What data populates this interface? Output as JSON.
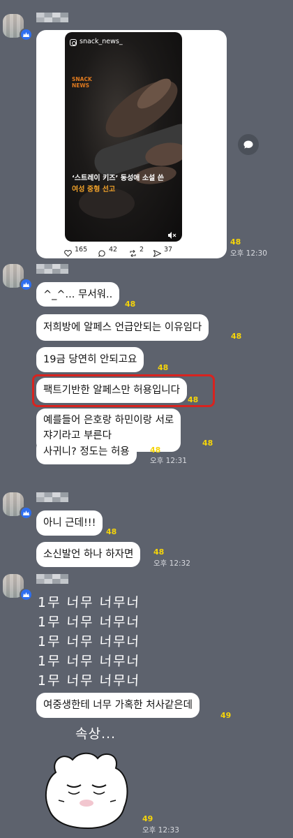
{
  "post": {
    "account": "snack_news_",
    "logo_line1": "SNACK",
    "logo_line2": "NEWS",
    "headline1": "‘스트레이 키즈’ 동성애 소설 쓴",
    "headline2": "여성 중형 선고",
    "likes": "165",
    "comments": "42",
    "reposts": "2",
    "shares": "37",
    "read_count": "48",
    "time": "오후 12:30"
  },
  "messages": [
    {
      "text": "^_^... 무서워..",
      "count": "48"
    },
    {
      "text": "저희방에 알페스 언급안되는 이유임다",
      "count": "48"
    },
    {
      "text": "19금 당연히 안되고요",
      "count": "48"
    },
    {
      "text": "팩트기반한 알페스만 허용입니다",
      "count": "48"
    },
    {
      "text": "예를들어 은호랑 하민이랑 서로\n쟈기라고 부른다",
      "count": "48"
    },
    {
      "text": "사귀니? 정도는 허용",
      "count": "48",
      "time": "오후 12:31"
    },
    {
      "text": "아니 근데!!!",
      "count": "48"
    },
    {
      "text": "소신발언 하나 하자면",
      "count": "48",
      "time": "오후 12:32"
    },
    {
      "text": "여중생한테 너무 가혹한 처사같은데",
      "count": "49"
    }
  ],
  "scribble_lines": [
    "1무 너무 너무너",
    "1무 너무 너무너",
    "1무 너무 너무너",
    "1무 너무 너무너",
    "1무 너무 너무너"
  ],
  "sticker": {
    "caption": "속상...",
    "count": "49",
    "time": "오후 12:33"
  },
  "colors": {
    "background": "#5d626d",
    "bubble": "#ffffff",
    "unread_count": "#f5d40a",
    "highlight": "#d8231f",
    "badge": "#2f6ff0"
  },
  "icons": [
    "crown-badge-icon",
    "instagram-icon",
    "mute-icon",
    "heart-icon",
    "comment-icon",
    "repost-icon",
    "send-icon",
    "share-icon"
  ]
}
